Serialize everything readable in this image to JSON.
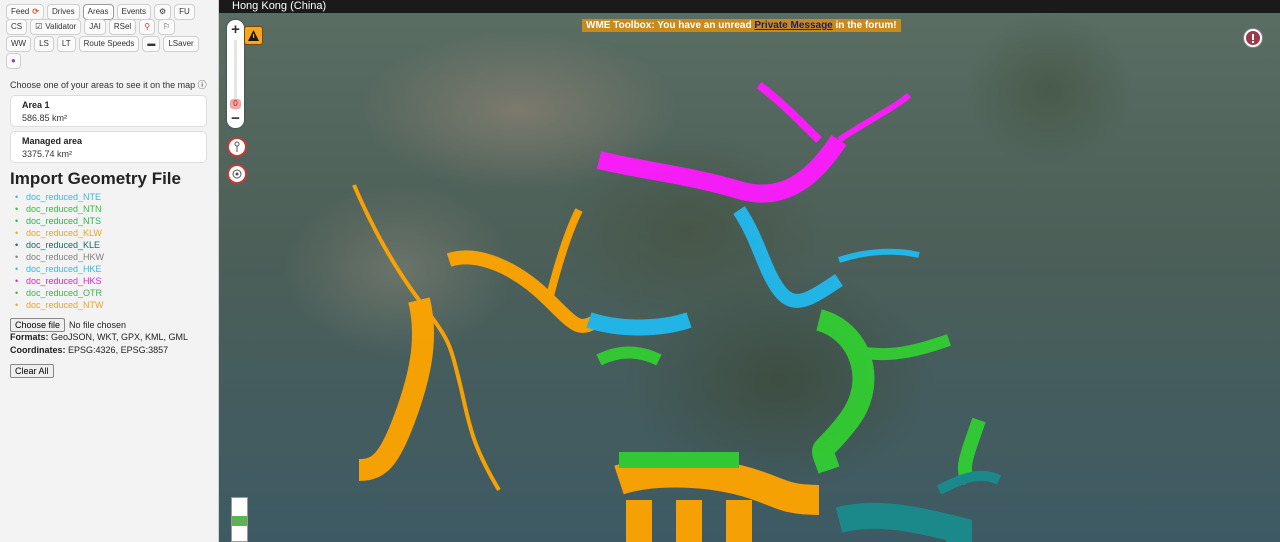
{
  "toolbar_rows": [
    [
      {
        "label": "Feed",
        "icon": "refresh-icon",
        "active": false
      },
      {
        "label": "Drives"
      },
      {
        "label": "Areas",
        "active": true
      },
      {
        "label": "Events"
      },
      {
        "label": "",
        "icon": "gear-icon"
      },
      {
        "label": "FU"
      }
    ],
    [
      {
        "label": "CS"
      },
      {
        "label": "Validator",
        "icon": "checkbox-icon"
      },
      {
        "label": "JAI"
      },
      {
        "label": "RSel"
      },
      {
        "label": "",
        "icon": "pin-icon"
      },
      {
        "label": "",
        "icon": "runner-icon"
      }
    ],
    [
      {
        "label": "WW"
      },
      {
        "label": "LS"
      },
      {
        "label": "LT"
      },
      {
        "label": "Route Speeds"
      },
      {
        "label": "",
        "icon": "car-icon"
      },
      {
        "label": "LSaver"
      }
    ],
    [
      {
        "label": "",
        "icon": "plugin-icon"
      }
    ]
  ],
  "areas": {
    "hint": "Choose one of your areas to see it on the map",
    "items": [
      {
        "name": "Area 1",
        "size": "586.85 km²"
      },
      {
        "name": "Managed area",
        "size": "3375.74 km²"
      }
    ]
  },
  "import": {
    "title": "Import Geometry File",
    "files": [
      {
        "name": "doc_reduced_NTE",
        "color": "#35b8e6"
      },
      {
        "name": "doc_reduced_NTN",
        "color": "#29c73a"
      },
      {
        "name": "doc_reduced_NTS",
        "color": "#29b44a"
      },
      {
        "name": "doc_reduced_KLW",
        "color": "#f2a31a"
      },
      {
        "name": "doc_reduced_KLE",
        "color": "#166a66"
      },
      {
        "name": "doc_reduced_HKW",
        "color": "#808080"
      },
      {
        "name": "doc_reduced_HKE",
        "color": "#30b8ec"
      },
      {
        "name": "doc_reduced_HKS",
        "color": "#e61ed6"
      },
      {
        "name": "doc_reduced_OTR",
        "color": "#38b64a"
      },
      {
        "name": "doc_reduced_NTW",
        "color": "#f2a31a"
      }
    ],
    "choose_label": "Choose file",
    "no_file": "No file chosen",
    "formats_label": "Formats:",
    "formats": "GeoJSON, WKT, GPX, KML, GML",
    "coords_label": "Coordinates:",
    "coords": "EPSG:4326, EPSG:3857",
    "clear": "Clear All"
  },
  "map": {
    "location": "Hong Kong (China)",
    "banner_pre": "WME Toolbox: You have an unread ",
    "banner_link": "Private Message",
    "banner_post": " in the forum!",
    "zoom_in": "+",
    "zoom_out": "−",
    "zoom_level": "0"
  },
  "colors": {
    "orange": "#ffa500",
    "magenta": "#ff1aff",
    "cyan": "#22b9ee",
    "green": "#32cd32",
    "teal": "#1a8c8c"
  }
}
